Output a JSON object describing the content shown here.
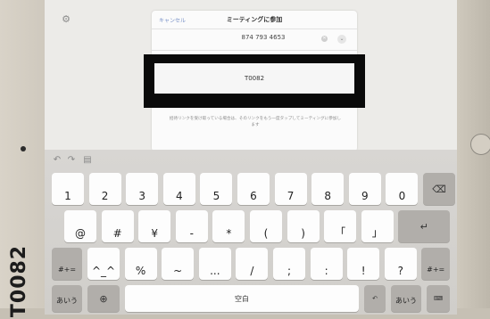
{
  "device": {
    "label": "T0082"
  },
  "dialog": {
    "cancel_label": "キャンセル",
    "title": "ミーティングに参加",
    "meeting_id": "874 793 4653",
    "clear_icon": "clear-icon",
    "dropdown_icon": "chevron-down-icon",
    "display_name": "T0082",
    "notice": "招待リンクを受け取っている場合は、そのリンクをもう一度タップしてミーティングに参加します"
  },
  "colors": {
    "accent": "#2e6ad8",
    "cancel": "#7a92c8",
    "redaction": "#0a0a0a"
  },
  "keyboard": {
    "toolbar_icons": [
      "undo-icon",
      "redo-icon",
      "paste-icon"
    ],
    "row1": [
      {
        "main": "1",
        "hint": ""
      },
      {
        "main": "2",
        "hint": ""
      },
      {
        "main": "3",
        "hint": ""
      },
      {
        "main": "4",
        "hint": ""
      },
      {
        "main": "5",
        "hint": ""
      },
      {
        "main": "6",
        "hint": ""
      },
      {
        "main": "7",
        "hint": ""
      },
      {
        "main": "8",
        "hint": ""
      },
      {
        "main": "9",
        "hint": ""
      },
      {
        "main": "0",
        "hint": ""
      }
    ],
    "row2": [
      {
        "main": "@",
        "hint": ""
      },
      {
        "main": "#",
        "hint": ""
      },
      {
        "main": "¥",
        "hint": ""
      },
      {
        "main": "-",
        "hint": ""
      },
      {
        "main": "*",
        "hint": ""
      },
      {
        "main": "(",
        "hint": ""
      },
      {
        "main": ")",
        "hint": ""
      },
      {
        "main": "「",
        "hint": ""
      },
      {
        "main": "」",
        "hint": ""
      }
    ],
    "row3": [
      {
        "main": "^_^",
        "hint": ""
      },
      {
        "main": "%",
        "hint": ""
      },
      {
        "main": "~",
        "hint": ""
      },
      {
        "main": "...",
        "hint": ""
      },
      {
        "main": "/",
        "hint": ""
      },
      {
        "main": ";",
        "hint": ""
      },
      {
        "main": ":",
        "hint": ""
      },
      {
        "main": "!",
        "hint": ""
      },
      {
        "main": "?",
        "hint": ""
      }
    ],
    "symbols_left_label": "#+=",
    "symbols_right_label": "#+=",
    "kana_left_label": "あいう",
    "kana_right_label": "あいう",
    "space_label": "空白",
    "icons": {
      "delete": "delete-icon",
      "return": "return-icon",
      "globe": "globe-icon",
      "undo_key": "undo-icon",
      "dismiss": "keyboard-dismiss-icon"
    }
  }
}
